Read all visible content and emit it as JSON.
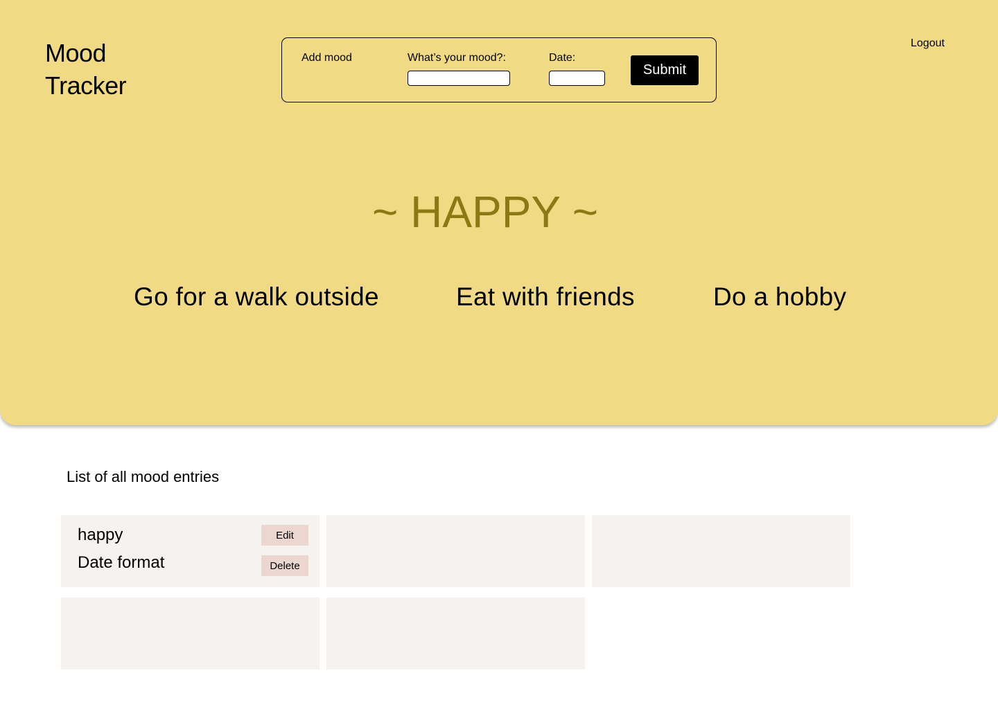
{
  "header": {
    "logo_line1": "Mood",
    "logo_line2": "Tracker",
    "logout_label": "Logout"
  },
  "form": {
    "title": "Add mood",
    "mood_label": "What’s your mood?:",
    "mood_value": "",
    "date_label": "Date:",
    "date_value": "",
    "submit_label": "Submit"
  },
  "current_mood": {
    "heading": "~ HAPPY ~",
    "suggestions": [
      "Go for a walk outside",
      "Eat with friends",
      "Do a hobby"
    ]
  },
  "entries": {
    "title": "List of all mood entries",
    "items": [
      {
        "mood": "happy",
        "date": "Date format",
        "edit_label": "Edit",
        "delete_label": "Delete"
      }
    ]
  },
  "colors": {
    "hero_background": "#F0DB84",
    "mood_accent": "#8B7A14",
    "card_background": "#F5F2EF",
    "card_button": "#EBD7D0",
    "submit_background": "#000000"
  }
}
